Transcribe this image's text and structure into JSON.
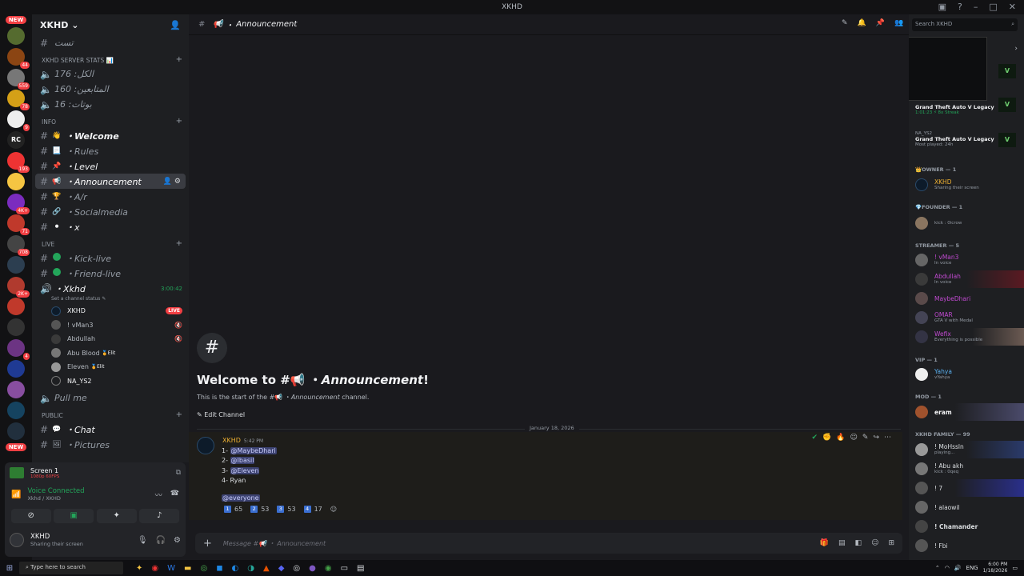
{
  "window": {
    "title": "XKHD"
  },
  "rail": {
    "new_label": "NEW",
    "badges": [
      "44",
      "559",
      "78",
      "9",
      "RC",
      "193",
      "4K+",
      "71",
      "708",
      "2K+",
      "4"
    ]
  },
  "sidebar": {
    "guild_name": "XKHD",
    "top_channel": "تست",
    "cat_stats": "XKHD SERVER STATS 📊",
    "stats": [
      "الكل: 176",
      "المتابعين: 160",
      "بوتات: 16"
    ],
    "cat_info": "INFO",
    "info_channels": [
      {
        "emoji": "👋",
        "label": "Welcome"
      },
      {
        "emoji": "📃",
        "label": "Rules"
      },
      {
        "emoji": "📌",
        "label": "Level"
      },
      {
        "emoji": "📢",
        "label": "Announcement"
      },
      {
        "emoji": "🏆",
        "label": "A/r"
      },
      {
        "emoji": "🔗",
        "label": "Socialmedia"
      },
      {
        "emoji": "⚫",
        "label": "x"
      }
    ],
    "cat_live": "LIVE",
    "live_channels": [
      "Kick-live",
      "Friend-live"
    ],
    "voice_channel": {
      "name": "Xkhd",
      "timer": "3:00:42",
      "status": "Set a channel status"
    },
    "voice_users": [
      {
        "name": "XKHD",
        "live": "LIVE"
      },
      {
        "name": "! vMan3",
        "live": ""
      },
      {
        "name": "Abdullah",
        "live": ""
      },
      {
        "name": "Abu Blood",
        "tag": "Elit"
      },
      {
        "name": "Eleven",
        "tag": "Elit"
      },
      {
        "name": "NA_YS2",
        "live": ""
      }
    ],
    "pullme": "Pull me",
    "cat_public": "PUBLIC",
    "public_channels": [
      {
        "emoji": "💬",
        "label": "Chat"
      },
      {
        "emoji": "🖼",
        "label": "Pictures"
      }
    ]
  },
  "panel": {
    "stream_title": "Screen 1",
    "stream_sub": "1080p 60FPS",
    "vc_status": "Voice Connected",
    "vc_sub": "Xkhd / XKHD",
    "user_name": "XKHD",
    "user_status": "Sharing their screen"
  },
  "chat": {
    "channel": "Announcement",
    "welcome_prefix": "Welcome to #📢 ・",
    "welcome_channel": "Announcement",
    "welcome_suffix": "!",
    "start_prefix": "This is the start of the #📢 ・",
    "start_channel": "Announcement",
    "start_suffix": " channel.",
    "edit_channel": "Edit Channel",
    "date": "January 18, 2026",
    "message": {
      "author": "XKHD",
      "time": "5:42 PM",
      "lines": [
        {
          "n": "1-",
          "who": "@MaybeDhari",
          "mention": true
        },
        {
          "n": "2-",
          "who": "@Ibasil",
          "mention": true
        },
        {
          "n": "3-",
          "who": "@Eleven",
          "mention": true
        },
        {
          "n": "4-",
          "who": "Ryan",
          "mention": false
        }
      ],
      "everyone": "@everyone",
      "reactions": [
        {
          "key": "1",
          "count": "65"
        },
        {
          "key": "2",
          "count": "53"
        },
        {
          "key": "3",
          "count": "53"
        },
        {
          "key": "4",
          "count": "17"
        }
      ]
    },
    "composer_placeholder": "Message #📢 ・ Announcement"
  },
  "members": {
    "search_placeholder": "Search XKHD",
    "games": [
      {
        "title": "Grand Theft Auto V Legacy",
        "sub": "1:01:23 ⚡ 8x Streak"
      },
      {
        "title": "Grand Theft Auto V Legacy",
        "sub": "Most played: 24h",
        "owner": "NA_YS2"
      }
    ],
    "groups": [
      {
        "label": "Owner — 1",
        "members": [
          {
            "name": "XKHD",
            "status": "Sharing their screen",
            "color": "#f0b232"
          }
        ]
      },
      {
        "label": "FOunder — 1",
        "members": [
          {
            "name": "",
            "status": "kick : 0icrow",
            "color": "#dbdee1"
          }
        ]
      },
      {
        "label": "STREAMER — 5",
        "members": [
          {
            "name": "! vMan3",
            "status": "In voice",
            "color": "#c04ad0"
          },
          {
            "name": "Abdullah",
            "status": "In voice",
            "color": "#c04ad0"
          },
          {
            "name": "MaybeDhari",
            "status": "",
            "color": "#c04ad0"
          },
          {
            "name": "OMAR",
            "status": "GTA V with Medal",
            "color": "#c04ad0"
          },
          {
            "name": "Wefix",
            "status": "Everything is possible",
            "color": "#c04ad0"
          }
        ]
      },
      {
        "label": "VIP — 1",
        "members": [
          {
            "name": "Yahya",
            "status": "vYahya",
            "color": "#5ab0f0"
          }
        ]
      },
      {
        "label": "MOD — 1",
        "members": [
          {
            "name": "eram",
            "status": "",
            "color": "#f2f3f5"
          }
        ]
      },
      {
        "label": "XKHD FAMILY — 99",
        "members": [
          {
            "name": "! MoHssln",
            "status": "playing...",
            "color": "#dbdee1"
          },
          {
            "name": "! Abu akh",
            "status": "kick : 0qeq",
            "color": "#dbdee1"
          },
          {
            "name": "! 7",
            "status": "",
            "color": "#dbdee1"
          },
          {
            "name": "! alaowil",
            "status": "",
            "color": "#dbdee1"
          },
          {
            "name": "! Chamander",
            "status": "",
            "color": "#dbdee1"
          },
          {
            "name": "! Fbi",
            "status": "",
            "color": "#dbdee1"
          }
        ]
      }
    ]
  },
  "taskbar": {
    "search_placeholder": "Type here to search",
    "lang": "ENG",
    "time": "6:00 PM",
    "date": "1/18/2026"
  }
}
